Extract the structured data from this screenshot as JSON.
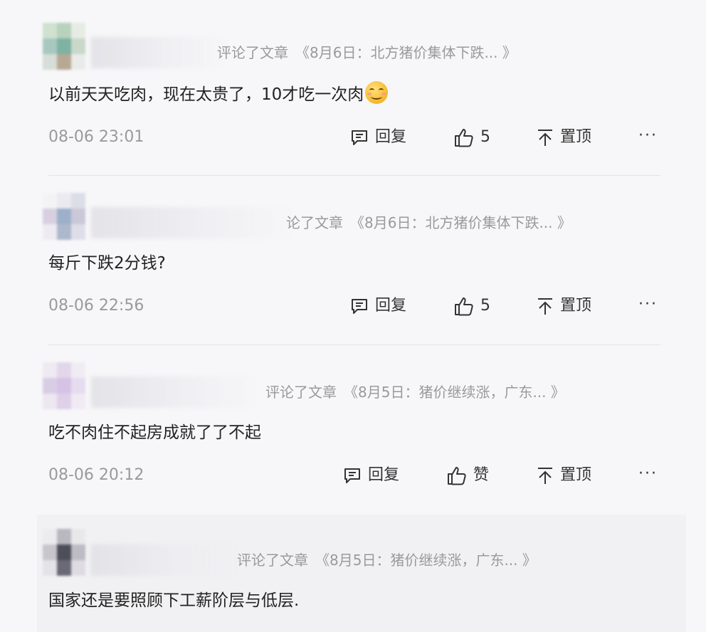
{
  "labels": {
    "reply": "回复",
    "pin": "置顶",
    "more": "···"
  },
  "comments": [
    {
      "meta_prefix": "评论了文章",
      "article": "《8月6日：北方猪价集体下跌... 》",
      "text": "以前天天吃肉，现在太贵了，10才吃一次肉",
      "emoji": "smiling-blush-emoji",
      "time": "08-06 23:01",
      "likes": "5"
    },
    {
      "meta_prefix": "论了文章",
      "article": "《8月6日：北方猪价集体下跌... 》",
      "text": "每斤下跌2分钱?",
      "time": "08-06 22:56",
      "likes": "5"
    },
    {
      "meta_prefix": "评论了文章",
      "article": "《8月5日：猪价继续涨，广东... 》",
      "text": "吃不肉住不起房成就了了不起",
      "time": "08-06 20:12",
      "likes": "赞"
    },
    {
      "meta_prefix": "评论了文章",
      "article": "《8月5日：猪价继续涨，广东... 》",
      "text": "国家还是要照顾下工薪阶层与低层."
    }
  ],
  "icons": {
    "reply": "comment-bubble-icon",
    "like": "thumbs-up-icon",
    "pin": "pin-top-icon"
  },
  "colors": {
    "background": "#f7f7f9",
    "meta_text": "#9a9a9a",
    "body_text": "#222222",
    "divider": "#e4e4e8"
  }
}
